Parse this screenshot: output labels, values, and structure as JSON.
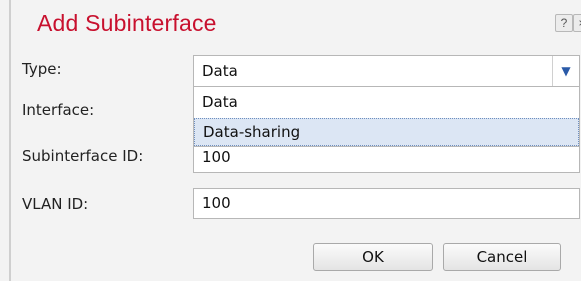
{
  "dialog": {
    "title": "Add Subinterface",
    "help_icon": "?",
    "close_icon": "×"
  },
  "form": {
    "type_label": "Type:",
    "type_value": "Data",
    "type_options": [
      "Data",
      "Data-sharing"
    ],
    "type_highlighted_option": "Data-sharing",
    "interface_label": "Interface:",
    "subinterface_id_label": "Subinterface ID:",
    "subinterface_id_value": "100",
    "vlan_id_label": "VLAN ID:",
    "vlan_id_value": "100"
  },
  "buttons": {
    "ok": "OK",
    "cancel": "Cancel"
  },
  "colors": {
    "title": "#c8102e",
    "highlight": "#dce6f4",
    "dropdown_arrow": "#2a5aa8"
  },
  "icons": {
    "dropdown_arrow": "chevron-down-icon",
    "help": "help-icon",
    "close": "close-icon"
  }
}
